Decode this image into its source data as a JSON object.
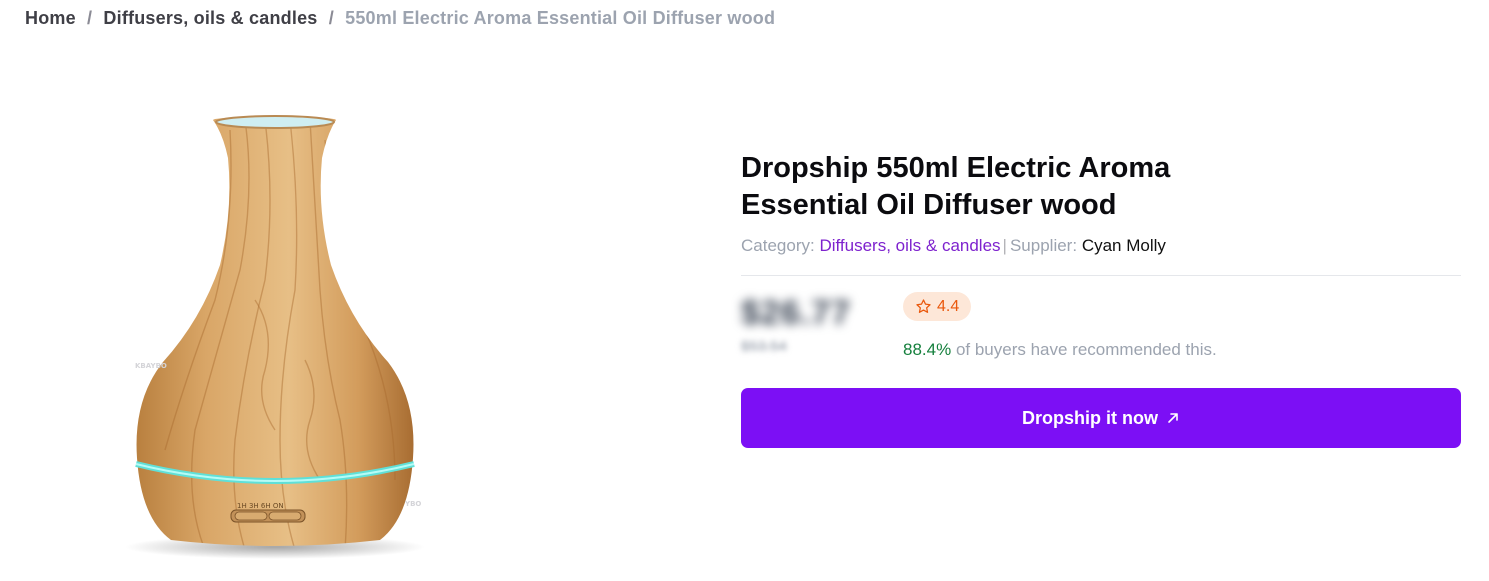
{
  "breadcrumb": {
    "home": "Home",
    "category": "Diffusers, oils & candles",
    "current": "550ml Electric Aroma Essential Oil Diffuser wood",
    "separator": "/"
  },
  "product": {
    "title_line1": "Dropship 550ml Electric Aroma",
    "title_line2": "Essential Oil Diffuser wood",
    "image_alt": "Wood grain electric aroma essential oil diffuser",
    "device_buttons_text": "1H 3H 6H ON",
    "watermark_left": "KBAYBO",
    "watermark_right": "YBO"
  },
  "meta": {
    "category_label": "Category:",
    "category_value": "Diffusers, oils & candles",
    "separator": "|",
    "supplier_label": "Supplier:",
    "supplier_value": "Cyan Molly"
  },
  "pricing": {
    "price": "$26.77",
    "old_price": "$53.54",
    "rating": "4.4",
    "recommend_percent": "88.4%",
    "recommend_text": "of buyers have recommended this."
  },
  "cta": {
    "label": "Dropship it now",
    "icon": "arrow-up-right-icon"
  },
  "colors": {
    "accent": "#7c0ff5",
    "link": "#7e22ce",
    "rating_bg": "#fde7d8",
    "rating_fg": "#ea580c",
    "recommend_green": "#15803d",
    "led_ring": "#5fe0d8"
  }
}
